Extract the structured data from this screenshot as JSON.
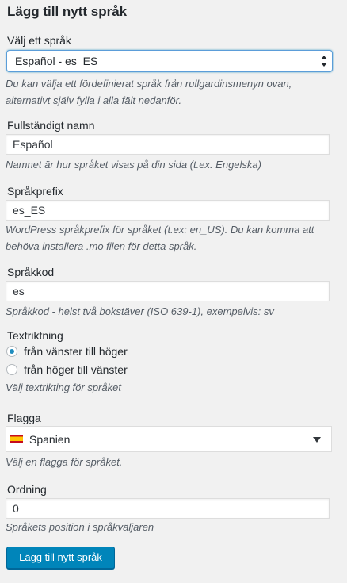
{
  "form": {
    "title": "Lägg till nytt språk",
    "language_select": {
      "label": "Välj ett språk",
      "value": "Español - es_ES",
      "description": "Du kan välja ett fördefinierat språk från rullgardinsmenyn ovan, alternativt själv fylla i alla fält nedanför."
    },
    "full_name": {
      "label": "Fullständigt namn",
      "value": "Español",
      "description": "Namnet är hur språket visas på din sida (t.ex. Engelska)"
    },
    "locale": {
      "label": "Språkprefix",
      "value": "es_ES",
      "description": "WordPress språkprefix för språket (t.ex: en_US). Du kan komma att behöva installera .mo filen för detta språk."
    },
    "code": {
      "label": "Språkkod",
      "value": "es",
      "description": "Språkkod - helst två bokstäver (ISO 639-1), exempelvis: sv"
    },
    "direction": {
      "label": "Textriktning",
      "options": [
        {
          "label": "från vänster till höger",
          "checked": true
        },
        {
          "label": "från höger till vänster",
          "checked": false
        }
      ],
      "description": "Välj textrikting för språket"
    },
    "flag": {
      "label": "Flagga",
      "value": "Spanien",
      "icon": "spain-flag-icon",
      "description": "Välj en flagga för språket."
    },
    "order": {
      "label": "Ordning",
      "value": "0",
      "description": "Språkets position i språkväljaren"
    },
    "submit_label": "Lägg till nytt språk"
  },
  "colors": {
    "primary_button": "#0085ba",
    "focus_border": "#5b9dd9",
    "radio_dot": "#1e8cbe"
  }
}
